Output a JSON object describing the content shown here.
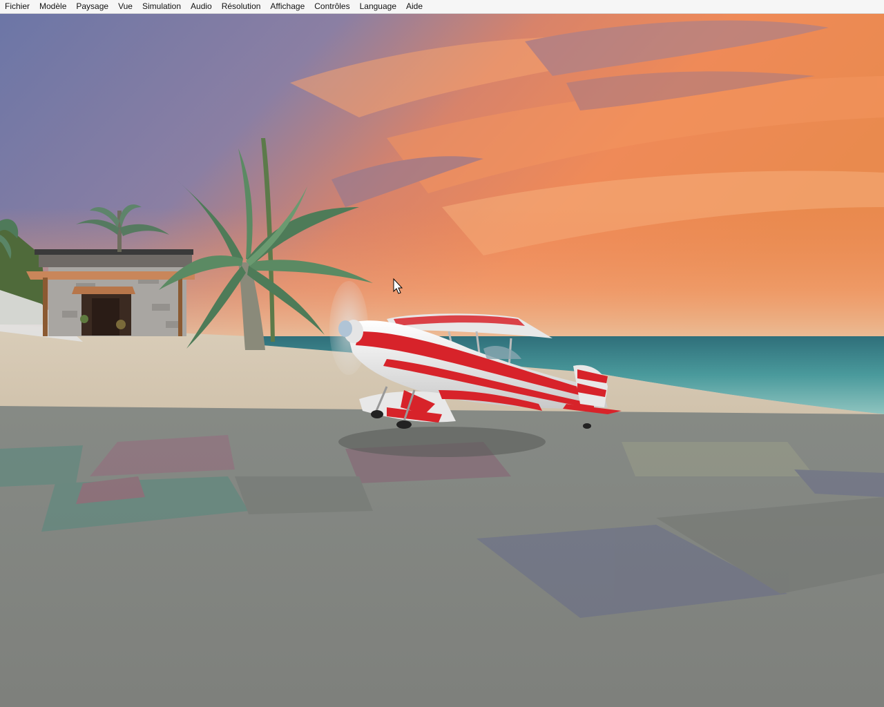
{
  "menubar": {
    "items": [
      {
        "label": "Fichier"
      },
      {
        "label": "Modèle"
      },
      {
        "label": "Paysage"
      },
      {
        "label": "Vue"
      },
      {
        "label": "Simulation"
      },
      {
        "label": "Audio"
      },
      {
        "label": "Résolution"
      },
      {
        "label": "Affichage"
      },
      {
        "label": "Contrôles"
      },
      {
        "label": "Language"
      },
      {
        "label": "Aide"
      }
    ]
  },
  "scene": {
    "sky_colors": {
      "top": "#6f7aa8",
      "glow": "#ef8c5a",
      "horizon": "#e9b27d"
    },
    "ground_color": "#7f827e",
    "sand_color": "#d6c8b4",
    "sea_color": "#4a9a9c",
    "aircraft_colors": {
      "primary": "#e8e8e8",
      "accent": "#d7232a"
    }
  }
}
